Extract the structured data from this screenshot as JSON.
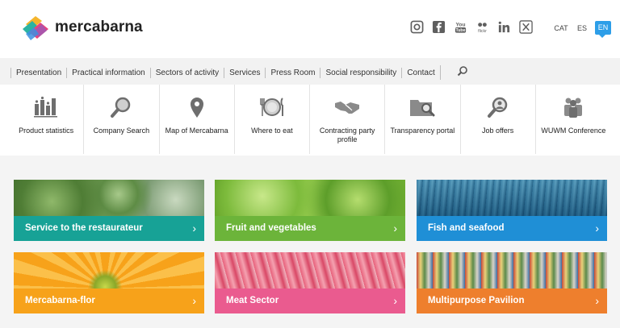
{
  "header": {
    "brand": "mercabarna",
    "socials": [
      "instagram-icon",
      "facebook-icon",
      "youtube-icon",
      "flickr-icon",
      "linkedin-icon",
      "x-icon"
    ],
    "languages": [
      "CAT",
      "ES",
      "EN"
    ],
    "active_language": "EN"
  },
  "nav": {
    "items": [
      "Presentation",
      "Practical information",
      "Sectors of activity",
      "Services",
      "Press Room",
      "Social responsibility",
      "Contact"
    ]
  },
  "quick_links": [
    {
      "label": "Product statistics",
      "icon": "bar-chart-icon"
    },
    {
      "label": "Company Search",
      "icon": "magnifier-icon"
    },
    {
      "label": "Map of Mercabarna",
      "icon": "map-pin-icon"
    },
    {
      "label": "Where to eat",
      "icon": "plate-cutlery-icon"
    },
    {
      "label": "Contracting party profile",
      "icon": "handshake-icon"
    },
    {
      "label": "Transparency portal",
      "icon": "folder-search-icon"
    },
    {
      "label": "Job offers",
      "icon": "person-search-icon"
    },
    {
      "label": "WUWM Conference",
      "icon": "group-icon"
    }
  ],
  "sectors": [
    {
      "label": "Service to the restaurateur",
      "color": "#17a296"
    },
    {
      "label": "Fruit and vegetables",
      "color": "#6cb43a"
    },
    {
      "label": "Fish and seafood",
      "color": "#1f8fd6"
    },
    {
      "label": "Mercabarna-flor",
      "color": "#f7a21a"
    },
    {
      "label": "Meat Sector",
      "color": "#ea5b8f"
    },
    {
      "label": "Multipurpose Pavilion",
      "color": "#ee7f2d"
    }
  ]
}
